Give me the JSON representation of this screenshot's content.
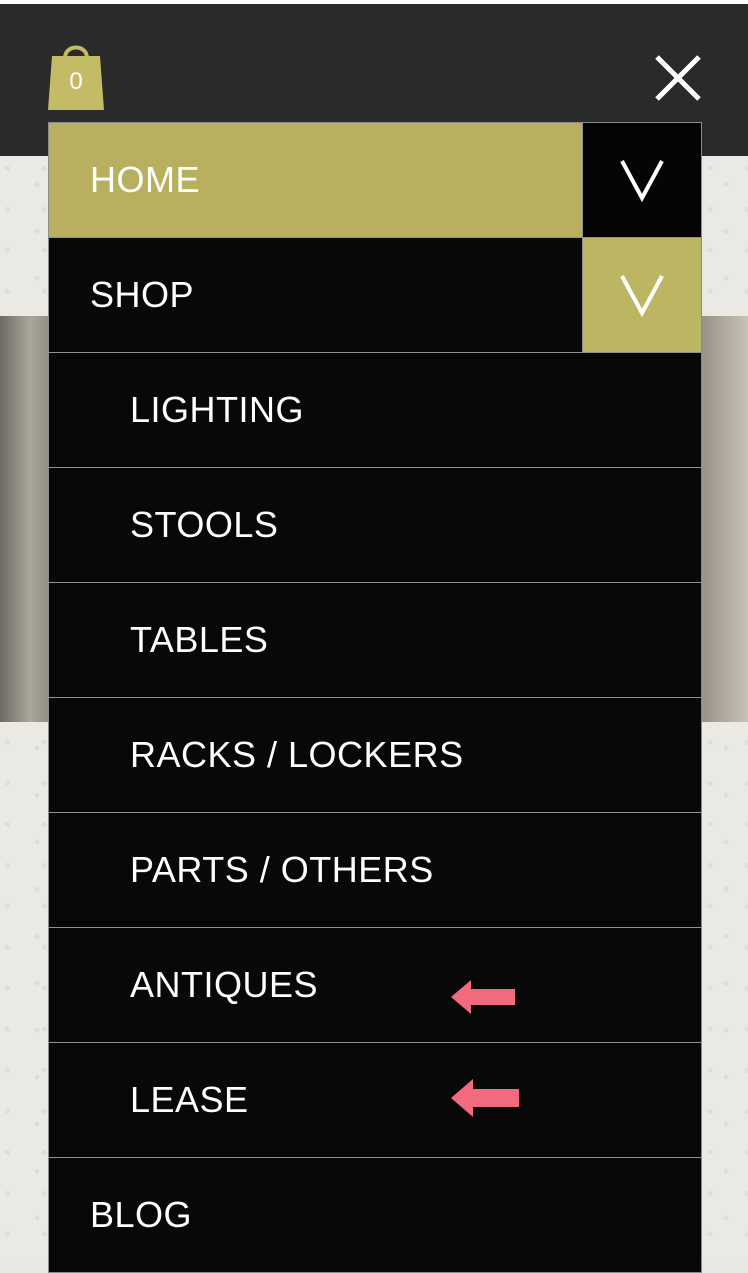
{
  "cart": {
    "count": "0",
    "icon": "shopping-bag-icon",
    "color": "#c3bb66"
  },
  "header": {
    "close_icon": "close-icon"
  },
  "menu": {
    "items": [
      {
        "label": "HOME",
        "level": 0,
        "active": true,
        "toggle": "dark"
      },
      {
        "label": "SHOP",
        "level": 0,
        "active": false,
        "toggle": "gold"
      },
      {
        "label": "LIGHTING",
        "level": 1
      },
      {
        "label": "STOOLS",
        "level": 1
      },
      {
        "label": "TABLES",
        "level": 1
      },
      {
        "label": "RACKS / LOCKERS",
        "level": 1
      },
      {
        "label": "PARTS / OTHERS",
        "level": 1
      },
      {
        "label": "ANTIQUES",
        "level": 1,
        "annotated": true
      },
      {
        "label": "LEASE",
        "level": 1,
        "annotated": true
      },
      {
        "label": "BLOG",
        "level": 0
      }
    ]
  },
  "colors": {
    "accent": "#bcb561",
    "annotation_arrow": "#f26a7e",
    "topbar": "#2b2a2b"
  }
}
